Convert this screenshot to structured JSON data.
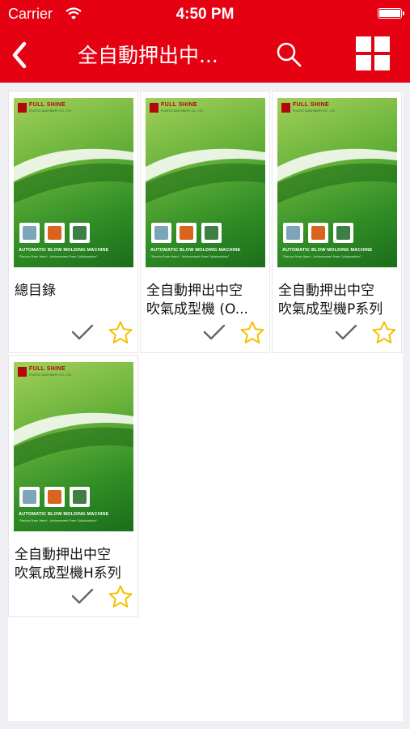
{
  "status_bar": {
    "carrier": "Carrier",
    "time": "4:50 PM"
  },
  "nav": {
    "title": "全自動押出中...",
    "back_icon": "chevron-left-icon",
    "search_icon": "search-icon",
    "grid_icon": "grid-view-icon"
  },
  "colors": {
    "brand_red": "#e50012",
    "star_yellow": "#f6c000",
    "check_gray": "#666666"
  },
  "cover": {
    "logo_text": "FULL SHINE",
    "logo_subtext": "PLASTIC MACHINERY CO., LTD.",
    "machine_title": "AUTOMATIC BLOW MOLDING MACHINE",
    "slogan": "\"Service From Heart - Achievement From Collaboration\""
  },
  "catalogs": [
    {
      "title_line1": "總目錄",
      "title_line2": ""
    },
    {
      "title_line1": "全自動押出中空",
      "title_line2": "吹氣成型機 (O..."
    },
    {
      "title_line1": "全自動押出中空",
      "title_line2": "吹氣成型機P系列"
    },
    {
      "title_line1": "全自動押出中空",
      "title_line2": "吹氣成型機H系列"
    }
  ]
}
